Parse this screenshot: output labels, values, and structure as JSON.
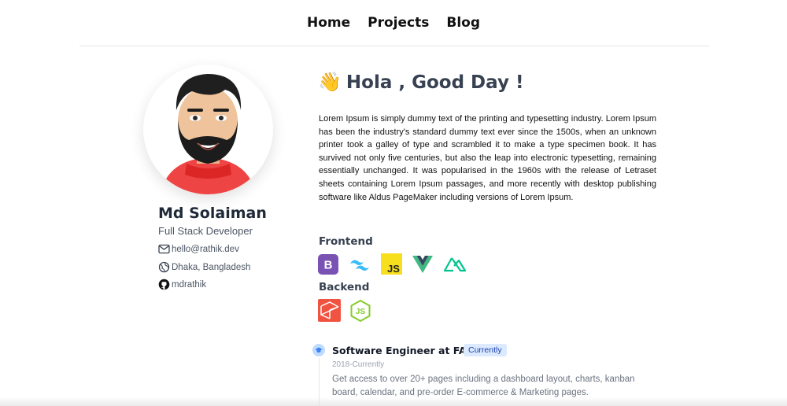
{
  "nav": {
    "items": [
      {
        "label": "Home"
      },
      {
        "label": "Projects"
      },
      {
        "label": "Blog"
      }
    ]
  },
  "profile": {
    "name": "Md Solaiman",
    "role": "Full Stack Developer",
    "email": "hello@rathik.dev",
    "location": "Dhaka, Bangladesh",
    "github": "mdrathik"
  },
  "intro": {
    "emoji": "👋",
    "greeting": "Hola , Good Day !",
    "paragraph": "Lorem Ipsum is simply dummy text of the printing and typesetting industry. Lorem Ipsum has been the industry's standard dummy text ever since the 1500s, when an unknown printer took a galley of type and scrambled it to make a type specimen book. It has survived not only five centuries, but also the leap into electronic typesetting, remaining essentially unchanged. It was popularised in the 1960s with the release of Letraset sheets containing Lorem Ipsum passages, and more recently with desktop publishing software like Aldus PageMaker including versions of Lorem Ipsum."
  },
  "skills": {
    "frontend_title": "Frontend",
    "frontend": [
      {
        "name": "bootstrap-icon",
        "text": "B",
        "color": "#7952b3"
      },
      {
        "name": "tailwind-icon",
        "color": "#38bdf8"
      },
      {
        "name": "javascript-icon",
        "text": "JS",
        "color": "#f7df1e"
      },
      {
        "name": "vue-icon",
        "color": "#41b883"
      },
      {
        "name": "nuxt-icon",
        "color": "#00c58e"
      }
    ],
    "backend_title": "Backend",
    "backend": [
      {
        "name": "laravel-icon",
        "color": "#f05340"
      },
      {
        "name": "nodejs-icon",
        "text": "JS",
        "color": "#83cd29"
      }
    ]
  },
  "experience": {
    "title": "Software Engineer at FANG",
    "badge": "Currently",
    "date": "2018-Currently",
    "description": "Get access to over 20+ pages including a dashboard layout, charts, kanban board, calendar, and pre-order E-commerce & Marketing pages."
  }
}
